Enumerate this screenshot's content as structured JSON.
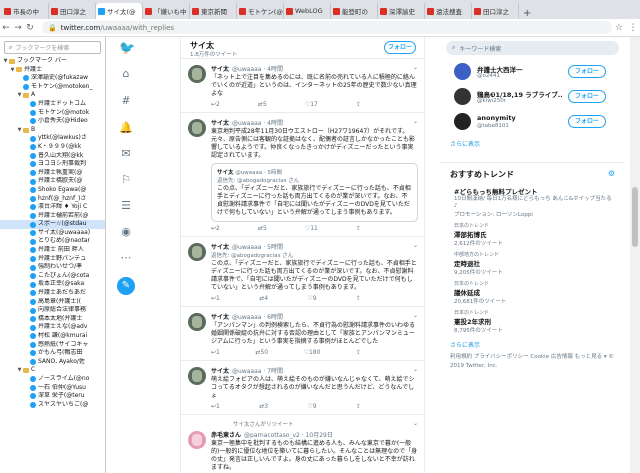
{
  "tabs": [
    {
      "label": "市長の中"
    },
    {
      "label": "田口淳之"
    },
    {
      "label": "サイ太(@"
    },
    {
      "label": "「嫌いも中"
    },
    {
      "label": "東京新聞"
    },
    {
      "label": "モトケン(@"
    },
    {
      "label": "WebLOG"
    },
    {
      "label": "能登町の"
    },
    {
      "label": "深澤諭史"
    },
    {
      "label": "遠法捜査"
    },
    {
      "label": "田口淳之"
    }
  ],
  "active_tab": 2,
  "address": {
    "host": "twitter.com",
    "path": "/uwaaaa/with_replies"
  },
  "sidebar": {
    "search_placeholder": "ブックマークを検索",
    "items": [
      {
        "label": "ブックマーク バー",
        "indent": 0,
        "type": "folder",
        "tw": "▼"
      },
      {
        "label": "弁護士",
        "indent": 1,
        "type": "folder",
        "tw": "▼"
      },
      {
        "label": "深澤諭史(@fukazaw",
        "indent": 2,
        "type": "bm"
      },
      {
        "label": "モトケン(@motoken_",
        "indent": 2,
        "type": "bm"
      },
      {
        "label": "A",
        "indent": 2,
        "type": "folder",
        "tw": "▼"
      },
      {
        "label": "弁護士ドットコム",
        "indent": 3,
        "type": "bm"
      },
      {
        "label": "モトケン(@motok",
        "indent": 3,
        "type": "bm"
      },
      {
        "label": "小倉秀夫(@Hideo",
        "indent": 3,
        "type": "bm"
      },
      {
        "label": "B",
        "indent": 2,
        "type": "folder",
        "tw": "▼"
      },
      {
        "label": "yttk(@lawkus)さ",
        "indent": 3,
        "type": "bm"
      },
      {
        "label": "K・９９９(@kk",
        "indent": 3,
        "type": "bm"
      },
      {
        "label": "普久山大翔(@kk",
        "indent": 3,
        "type": "bm"
      },
      {
        "label": "ヨコヨシ刑事裁判",
        "indent": 3,
        "type": "bm"
      },
      {
        "label": "弁護士執重実(@",
        "indent": 3,
        "type": "bm"
      },
      {
        "label": "弁護士橋欧夫(@",
        "indent": 3,
        "type": "bm"
      },
      {
        "label": "Shoko Egawa(@",
        "indent": 3,
        "type": "bm"
      },
      {
        "label": "hznf(@_hznf_)さ",
        "indent": 3,
        "type": "bm"
      },
      {
        "label": "濱台洋輝 ♦ Yoji C",
        "indent": 3,
        "type": "bm"
      },
      {
        "label": "弁護士樋前若前(@",
        "indent": 3,
        "type": "bm"
      },
      {
        "label": "スポー☆(@stdau",
        "indent": 3,
        "type": "bm",
        "selected": true
      },
      {
        "label": "サイ太(@uwaaaa)",
        "indent": 3,
        "type": "bm"
      },
      {
        "label": "とりむめ(@naotar",
        "indent": 3,
        "type": "bm"
      },
      {
        "label": "弁護士 前田 畔人",
        "indent": 3,
        "type": "bm"
      },
      {
        "label": "弁護士野パンテュ",
        "indent": 3,
        "type": "bm"
      },
      {
        "label": "強制わいせつ/準",
        "indent": 3,
        "type": "bm"
      },
      {
        "label": "こたぴょん(@cota",
        "indent": 3,
        "type": "bm"
      },
      {
        "label": "坂本正幸(@saka",
        "indent": 3,
        "type": "bm"
      },
      {
        "label": "弁護士あだちあだ",
        "indent": 3,
        "type": "bm"
      },
      {
        "label": "高島章(弁護士)(",
        "indent": 3,
        "type": "bm"
      },
      {
        "label": "向原総合法律事務",
        "indent": 3,
        "type": "bm"
      },
      {
        "label": "橋本太地(弁護士",
        "indent": 3,
        "type": "bm"
      },
      {
        "label": "弁護士えな(@adv",
        "indent": 3,
        "type": "bm"
      },
      {
        "label": "村松 謙(@kmurai",
        "indent": 3,
        "type": "bm"
      },
      {
        "label": "感熱紙(サイコキャ",
        "indent": 3,
        "type": "bm"
      },
      {
        "label": "かもん弓(鴨志田",
        "indent": 3,
        "type": "bm"
      },
      {
        "label": "SANO, Ayako/佐",
        "indent": 3,
        "type": "bm"
      },
      {
        "label": "C",
        "indent": 2,
        "type": "folder",
        "tw": "▼"
      },
      {
        "label": "ノースライム(@no",
        "indent": 3,
        "type": "bm"
      },
      {
        "label": "一石 伯仲(@Yusu",
        "indent": 3,
        "type": "bm"
      },
      {
        "label": "深草 栄子(@teru",
        "indent": 3,
        "type": "bm"
      },
      {
        "label": "スヤスヤいちご(@",
        "indent": 3,
        "type": "bm"
      }
    ]
  },
  "profile": {
    "name": "サイ太",
    "tweet_count": "1.8万件のツイート",
    "follow_label": "フォロー"
  },
  "tweets": [
    {
      "name": "サイ太",
      "handle": "@uwaaaa",
      "time": "4時間",
      "reply_to": "",
      "text": "「ネット上で注目を集めるのには、既に名前の売れている人に積極的に絡んでいくのが近道」というのは、インターネットの25年の歴史で数少ない真理よな",
      "acts": [
        "2",
        "5",
        "17",
        ""
      ],
      "quote": null,
      "avatar": "green"
    },
    {
      "name": "サイ太",
      "handle": "@uwaaaa",
      "time": "4時間",
      "reply_to": "",
      "text": "東京地判平成28年11月30日ウエストロー（H27ワ19647）がそれです。元々、原告側には客観的な証拠はなく、配偶者の証言しかなかったことも影響しているようです。仲良くなったきっかけがディズニーだったという事実認定されています。",
      "acts": [
        "2",
        "5",
        "11",
        ""
      ],
      "quote": {
        "name": "サイ太",
        "handle": "@uwaaaa",
        "time": "5時間",
        "reply_to": "返信先: @abogadogracias さん",
        "text": "この点、「ディズニーだと、家族旅行でディズニーに行った話も、不貞相手とディズニーに行った話も両方出てくるのが業が深いです。なお、不貞慰謝料請求事件で「自宅には聞いたがディズニーのDVDを見ていただけで何もしていない」という弁解が通ってしまう事例もあります。"
      },
      "avatar": "green"
    },
    {
      "name": "サイ太",
      "handle": "@uwaaaa",
      "time": "5時間",
      "reply_to": "返信先: @abogadogracias さん",
      "text": "この点、「ディズニーだと、家族旅行でディズニーに行った話も、不貞相手とディズニーに行った話も両方出てくるのが業が深いです。なお、不貞慰謝料請求事件で、「自宅には聞いたがディズニーのDVDを見ていただけで何もしていない」という弁解が通ってしまう事例もあります。",
      "acts": [
        "1",
        "4",
        "9",
        ""
      ],
      "quote": null,
      "avatar": "green"
    },
    {
      "name": "サイ太",
      "handle": "@uwaaaa",
      "time": "6時間",
      "reply_to": "",
      "text": "「アンパンマン」の判例検索したら、不貞行為の慰謝料請求事件のいわゆる婚姻関係破綻の抗弁に対する否認の理由として「家族とアンパンマンミュージアムに行った」という事実を指摘する事例がほとんどでした",
      "acts": [
        "1",
        "50",
        "180",
        ""
      ],
      "quote": null,
      "avatar": "green"
    },
    {
      "name": "サイ太",
      "handle": "@uwaaaa",
      "time": "7時間",
      "reply_to": "",
      "text": "萌え絵フォビアの人は、萌え絵そのものが嫌いなんじゃなくて、萌え絵でシコってるオタクが想起されるのが嫌いなんだと思うんだけど、どうなんでしょ",
      "acts": [
        "1",
        "3",
        "9",
        ""
      ],
      "quote": null,
      "avatar": "green"
    },
    {
      "name": "赤毛東さん",
      "handle": "@parnacottaso_v2",
      "time": "10月29日",
      "reply_to": "",
      "retweet_ctx": "サイ太さんがリツイート",
      "text": "東京一極集中を批判するものも結構に進める人も、みんな東京で暮か(一般的)一般的に優位な地位を築いてに暮らしたい。そんなことは無理なので「身の丈」発言は正しいんですよ。身の丈にあった暮らしをしないと不幸が訪れますね。",
      "acts": [
        "1",
        "47",
        "78",
        ""
      ],
      "quote": null,
      "avatar": "pink"
    }
  ],
  "right": {
    "search_placeholder": "キーワード検索",
    "suggestions": [
      {
        "name": "弁護士大西洋一",
        "handle": "@o2441",
        "follow": "フォロー",
        "color": "#3b5fc4"
      },
      {
        "name": "鶏鳥❸1/18,19 ラブライブ...",
        "handle": "@kiwi250r",
        "follow": "フォロー",
        "color": "#333333"
      },
      {
        "name": "anonymity",
        "handle": "@tabe8101",
        "follow": "フォロー",
        "color": "#222222"
      }
    ],
    "more_label": "さらに表示",
    "trends_title": "おすすめトレンド",
    "trends": [
      {
        "ctx": "",
        "name": "#どらもっち無料プレゼント",
        "desc": "10日間漢納/ 毎日1万名様にどらもっち あんこ&ホイップ当たる♪",
        "count": "プロモーション: ローソンLoppi"
      },
      {
        "ctx": "日本のトレンド",
        "name": "澤部拓博氏",
        "desc": "",
        "count": "2,612件のツイート"
      },
      {
        "ctx": "中部地方のトレンド",
        "name": "定時退社",
        "desc": "",
        "count": "9,205件のツイート"
      },
      {
        "ctx": "日本のトレンド",
        "name": "議休延成",
        "desc": "",
        "count": "20,681件のツイート"
      },
      {
        "ctx": "日本のトレンド",
        "name": "憲投2年求刑",
        "desc": "",
        "count": "8,795件のツイート"
      }
    ],
    "trends_more": "さらに表示",
    "footer": [
      "利用規約",
      "プライバシーポリシー",
      "Cookie",
      "広告情報",
      "もっと見る ▾",
      "© 2019 Twitter, Inc."
    ]
  }
}
